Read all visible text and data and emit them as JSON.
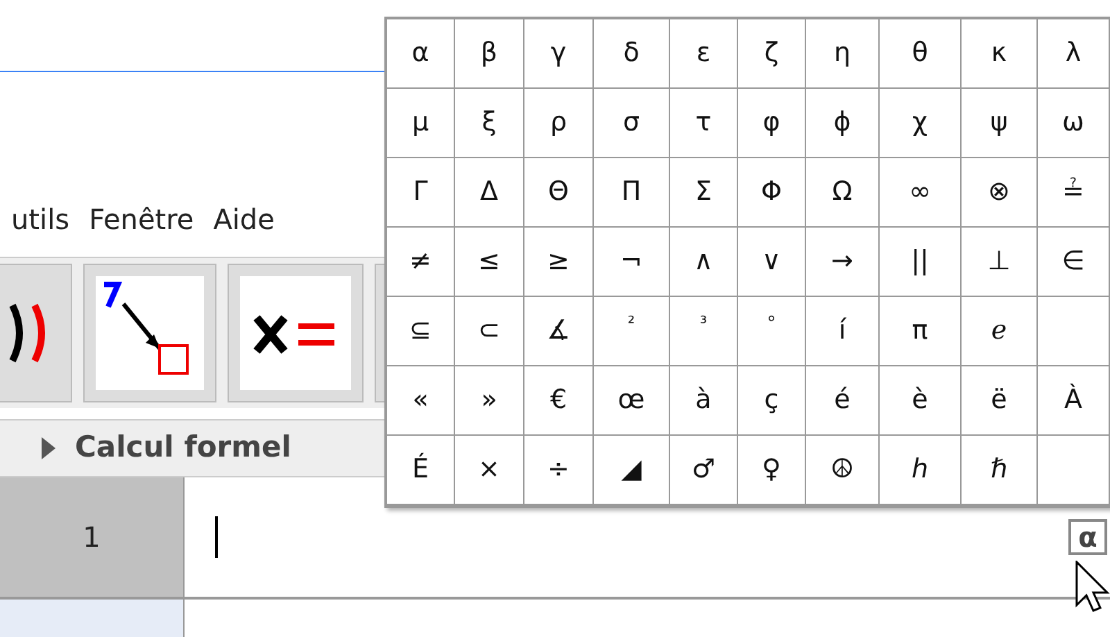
{
  "menu": [
    "utils",
    "Fenêtre",
    "Aide"
  ],
  "panel": {
    "title": "Calcul formel",
    "expanded": false
  },
  "rows": [
    {
      "number": "1",
      "kind": "input"
    },
    {
      "kind": "empty"
    }
  ],
  "symbol_button": "α",
  "symbols": [
    [
      "α",
      "β",
      "γ",
      "δ",
      "ε",
      "ζ",
      "η",
      "θ",
      "κ",
      "λ"
    ],
    [
      "μ",
      "ξ",
      "ρ",
      "σ",
      "τ",
      "φ",
      "ϕ",
      "χ",
      "ψ",
      "ω"
    ],
    [
      "Γ",
      "Δ",
      "Θ",
      "Π",
      "Σ",
      "Φ",
      "Ω",
      "∞",
      "⊗",
      "≟"
    ],
    [
      "≠",
      "≤",
      "≥",
      "¬",
      "∧",
      "∨",
      "→",
      "||",
      "⊥",
      "∈"
    ],
    [
      "⊆",
      "⊂",
      "∡",
      "²",
      "³",
      "°",
      "í",
      "π",
      "ℯ"
    ],
    [
      "«",
      "»",
      "€",
      "œ",
      "à",
      "ç",
      "é",
      "è",
      "ë",
      "À"
    ],
    [
      "É",
      "×",
      "÷",
      "◢",
      "♂",
      "♀",
      "☮",
      "ℎ",
      "ℏ"
    ]
  ]
}
